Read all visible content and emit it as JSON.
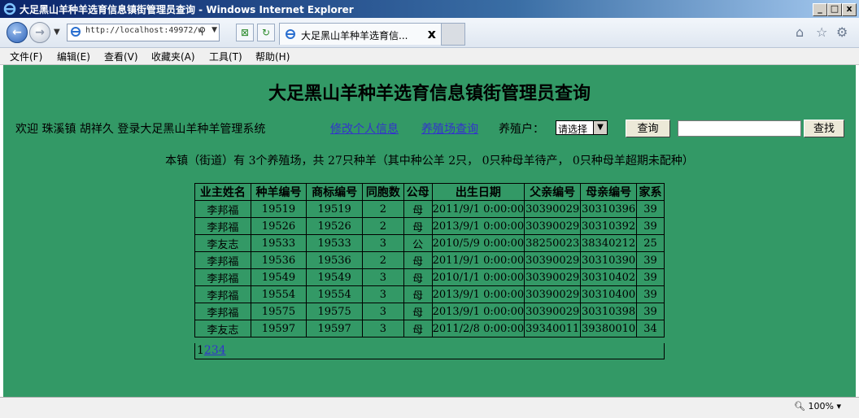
{
  "window": {
    "title": "大足黑山羊种羊选育信息镇街管理员查询 - Windows Internet Explorer",
    "controls": [
      "_",
      "□",
      "x"
    ]
  },
  "browser": {
    "address": "http://localhost:49972/w",
    "tab_title": "大足黑山羊种羊选育信...",
    "tab_close": "x",
    "zoom": "100%"
  },
  "menu": [
    "文件(F)",
    "编辑(E)",
    "查看(V)",
    "收藏夹(A)",
    "工具(T)",
    "帮助(H)"
  ],
  "page": {
    "title": "大足黑山羊种羊选育信息镇街管理员查询",
    "welcome": "欢迎 珠溪镇   胡祥久 登录大足黑山羊种羊管理系统",
    "edit_profile_link": "修改个人信息",
    "farm_query_link": "养殖场查询",
    "breeder_label": "养殖户：",
    "breeder_select": "请选择",
    "query_button": "查询",
    "search_value": "",
    "search_button": "查找",
    "summary": "本镇（街道）有 3个养殖场，共 27只种羊（其中种公羊 2只， 0只种母羊待产， 0只种母羊超期未配种）"
  },
  "table": {
    "headers": [
      "业主姓名",
      "种羊编号",
      "商标编号",
      "同胞数",
      "公母",
      "出生日期",
      "父亲编号",
      "母亲编号",
      "家系"
    ],
    "rows": [
      [
        "李邦福",
        "19519",
        "19519",
        "2",
        "母",
        "2011/9/1 0:00:00",
        "30390029",
        "30310396",
        "39"
      ],
      [
        "李邦福",
        "19526",
        "19526",
        "2",
        "母",
        "2013/9/1 0:00:00",
        "30390029",
        "30310392",
        "39"
      ],
      [
        "李友志",
        "19533",
        "19533",
        "3",
        "公",
        "2010/5/9 0:00:00",
        "38250023",
        "38340212",
        "25"
      ],
      [
        "李邦福",
        "19536",
        "19536",
        "2",
        "母",
        "2011/9/1 0:00:00",
        "30390029",
        "30310390",
        "39"
      ],
      [
        "李邦福",
        "19549",
        "19549",
        "3",
        "母",
        "2010/1/1 0:00:00",
        "30390029",
        "30310402",
        "39"
      ],
      [
        "李邦福",
        "19554",
        "19554",
        "3",
        "母",
        "2013/9/1 0:00:00",
        "30390029",
        "30310400",
        "39"
      ],
      [
        "李邦福",
        "19575",
        "19575",
        "3",
        "母",
        "2013/9/1 0:00:00",
        "30390029",
        "30310398",
        "39"
      ],
      [
        "李友志",
        "19597",
        "19597",
        "3",
        "母",
        "2011/2/8 0:00:00",
        "39340011",
        "39380010",
        "34"
      ]
    ],
    "pager": {
      "current": "1",
      "pages": [
        "2",
        "3",
        "4"
      ]
    }
  },
  "colors": {
    "page_bg": "#339966",
    "link": "#3333cc"
  }
}
